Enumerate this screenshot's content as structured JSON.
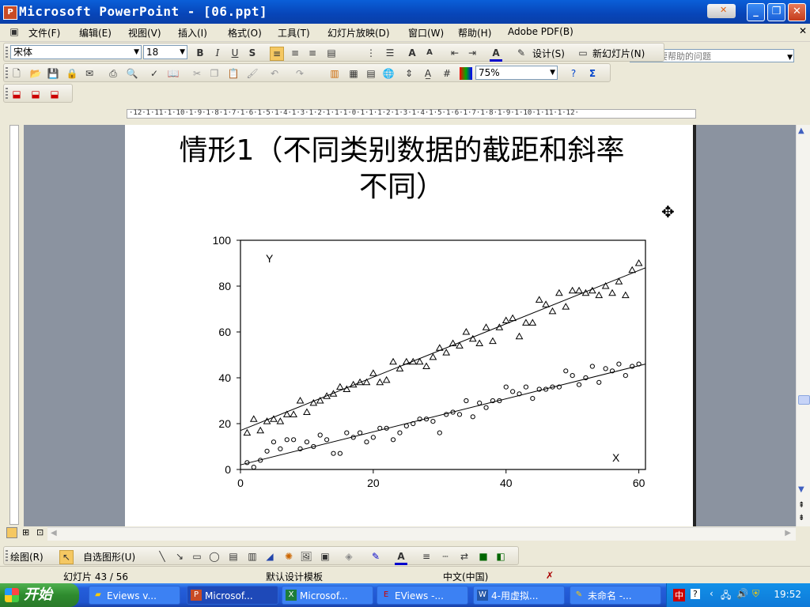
{
  "window": {
    "title": "Microsoft PowerPoint - [06.ppt]",
    "app_icon": "P"
  },
  "menu": {
    "items": [
      "文件(F)",
      "编辑(E)",
      "视图(V)",
      "插入(I)",
      "格式(O)",
      "工具(T)",
      "幻灯片放映(D)",
      "窗口(W)",
      "帮助(H)",
      "Adobe PDF(B)"
    ],
    "help_placeholder": "键入需要帮助的问题"
  },
  "format_toolbar": {
    "font": "宋体",
    "size": "18",
    "design_label": "设计(S)",
    "new_slide_label": "新幻灯片(N)"
  },
  "standard_toolbar": {
    "zoom": "75%"
  },
  "ruler": {
    "labels": "·12·1·11·1·10·1·9·1·8·1·7·1·6·1·5·1·4·1·3·1·2·1·1·1·0·1·1·1·2·1·3·1·4·1·5·1·6·1·7·1·8·1·9·1·10·1·11·1·12·"
  },
  "slide": {
    "title_line1": "情形1（不同类别数据的截距和斜率",
    "title_line2": "不同）"
  },
  "chart_data": {
    "type": "scatter",
    "title": "",
    "series_labels": [
      "Y",
      "X"
    ],
    "xlim": [
      0,
      61
    ],
    "ylim": [
      0,
      100
    ],
    "xticks": [
      0,
      20,
      40,
      60
    ],
    "yticks": [
      0,
      20,
      40,
      60,
      80,
      100
    ],
    "series": [
      {
        "marker": "triangle",
        "x": [
          1,
          2,
          3,
          4,
          5,
          6,
          7,
          8,
          9,
          10,
          11,
          12,
          13,
          14,
          15,
          16,
          17,
          18,
          19,
          20,
          21,
          22,
          23,
          24,
          25,
          26,
          27,
          28,
          29,
          30,
          31,
          32,
          33,
          34,
          35,
          36,
          37,
          38,
          39,
          40,
          41,
          42,
          43,
          44,
          45,
          46,
          47,
          48,
          49,
          50,
          51,
          52,
          53,
          54,
          55,
          56,
          57,
          58,
          59,
          60
        ],
        "y": [
          16,
          22,
          17,
          21,
          22,
          21,
          24,
          24,
          30,
          25,
          29,
          30,
          32,
          33,
          36,
          35,
          37,
          38,
          38,
          42,
          38,
          39,
          47,
          44,
          47,
          47,
          47,
          45,
          49,
          53,
          51,
          55,
          54,
          60,
          57,
          55,
          62,
          56,
          62,
          65,
          66,
          58,
          64,
          64,
          74,
          72,
          69,
          77,
          71,
          78,
          78,
          77,
          78,
          76,
          80,
          77,
          82,
          76,
          87,
          90
        ],
        "fit": [
          17,
          88
        ]
      },
      {
        "marker": "circle",
        "x": [
          1,
          2,
          3,
          4,
          5,
          6,
          7,
          8,
          9,
          10,
          11,
          12,
          13,
          14,
          15,
          16,
          17,
          18,
          19,
          20,
          21,
          22,
          23,
          24,
          25,
          26,
          27,
          28,
          29,
          30,
          31,
          32,
          33,
          34,
          35,
          36,
          37,
          38,
          39,
          40,
          41,
          42,
          43,
          44,
          45,
          46,
          47,
          48,
          49,
          50,
          51,
          52,
          53,
          54,
          55,
          56,
          57,
          58,
          59,
          60
        ],
        "y": [
          3,
          1,
          4,
          8,
          12,
          9,
          13,
          13,
          9,
          12,
          10,
          15,
          13,
          7,
          7,
          16,
          14,
          16,
          12,
          14,
          18,
          18,
          13,
          16,
          19,
          20,
          22,
          22,
          21,
          16,
          24,
          25,
          24,
          30,
          23,
          29,
          27,
          30,
          30,
          36,
          34,
          33,
          36,
          31,
          35,
          35,
          36,
          36,
          43,
          41,
          37,
          40,
          45,
          38,
          44,
          43,
          46,
          41,
          45,
          46
        ],
        "fit": [
          2,
          46
        ]
      }
    ]
  },
  "status": {
    "slide_info": "幻灯片 43 / 56",
    "template": "默认设计模板",
    "language": "中文(中国)"
  },
  "drawbar": {
    "draw_label": "绘图(R)",
    "autoshape_label": "自选图形(U)"
  },
  "taskbar": {
    "start": "开始",
    "tasks": [
      "Eviews v...",
      "Microsof...",
      "Microsof...",
      "EViews -...",
      "4-用虚拟...",
      "未命名 -..."
    ],
    "clock": "19:52"
  }
}
